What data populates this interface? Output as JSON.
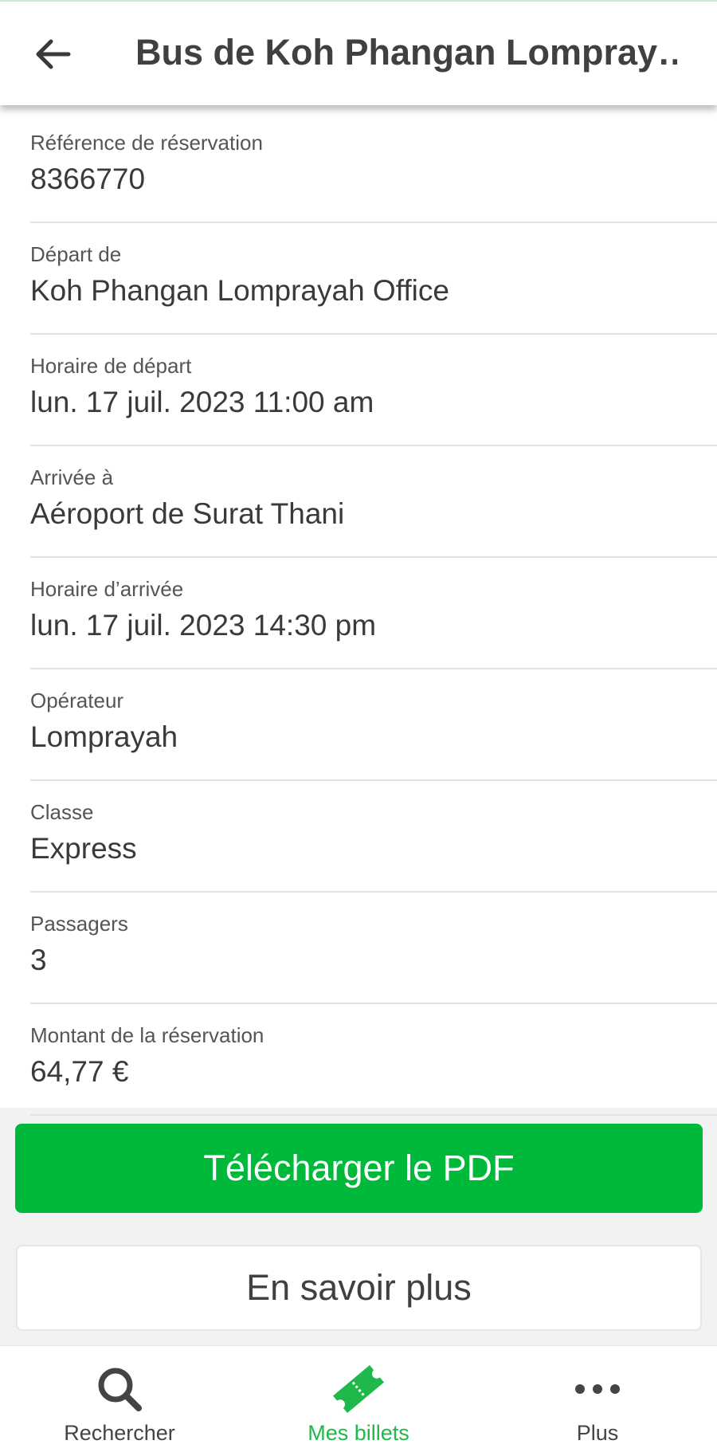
{
  "header": {
    "title": "Bus de Koh Phangan Lompray…",
    "back_icon": "arrow-left-icon"
  },
  "details": [
    {
      "label": "Référence de réservation",
      "value": "8366770"
    },
    {
      "label": "Départ de",
      "value": "Koh Phangan Lomprayah Office"
    },
    {
      "label": "Horaire de départ",
      "value": "lun. 17 juil. 2023 11:00 am"
    },
    {
      "label": "Arrivée à",
      "value": "Aéroport de Surat Thani"
    },
    {
      "label": "Horaire d’arrivée",
      "value": "lun. 17 juil. 2023 14:30 pm"
    },
    {
      "label": "Opérateur",
      "value": "Lomprayah"
    },
    {
      "label": "Classe",
      "value": "Express"
    },
    {
      "label": "Passagers",
      "value": "3"
    },
    {
      "label": "Montant de la réservation",
      "value": "64,77 €"
    }
  ],
  "actions": {
    "download_pdf": "Télécharger le PDF",
    "learn_more": "En savoir plus"
  },
  "bottom_nav": {
    "items": [
      {
        "label": "Rechercher",
        "icon": "search-icon",
        "active": false
      },
      {
        "label": "Mes billets",
        "icon": "ticket-icon",
        "active": true
      },
      {
        "label": "Plus",
        "icon": "more-dots-icon",
        "active": false
      }
    ]
  },
  "colors": {
    "accent": "#00b93a",
    "active_nav": "#1fb84a",
    "text_primary": "#3a3a3a",
    "text_secondary": "#555555"
  }
}
